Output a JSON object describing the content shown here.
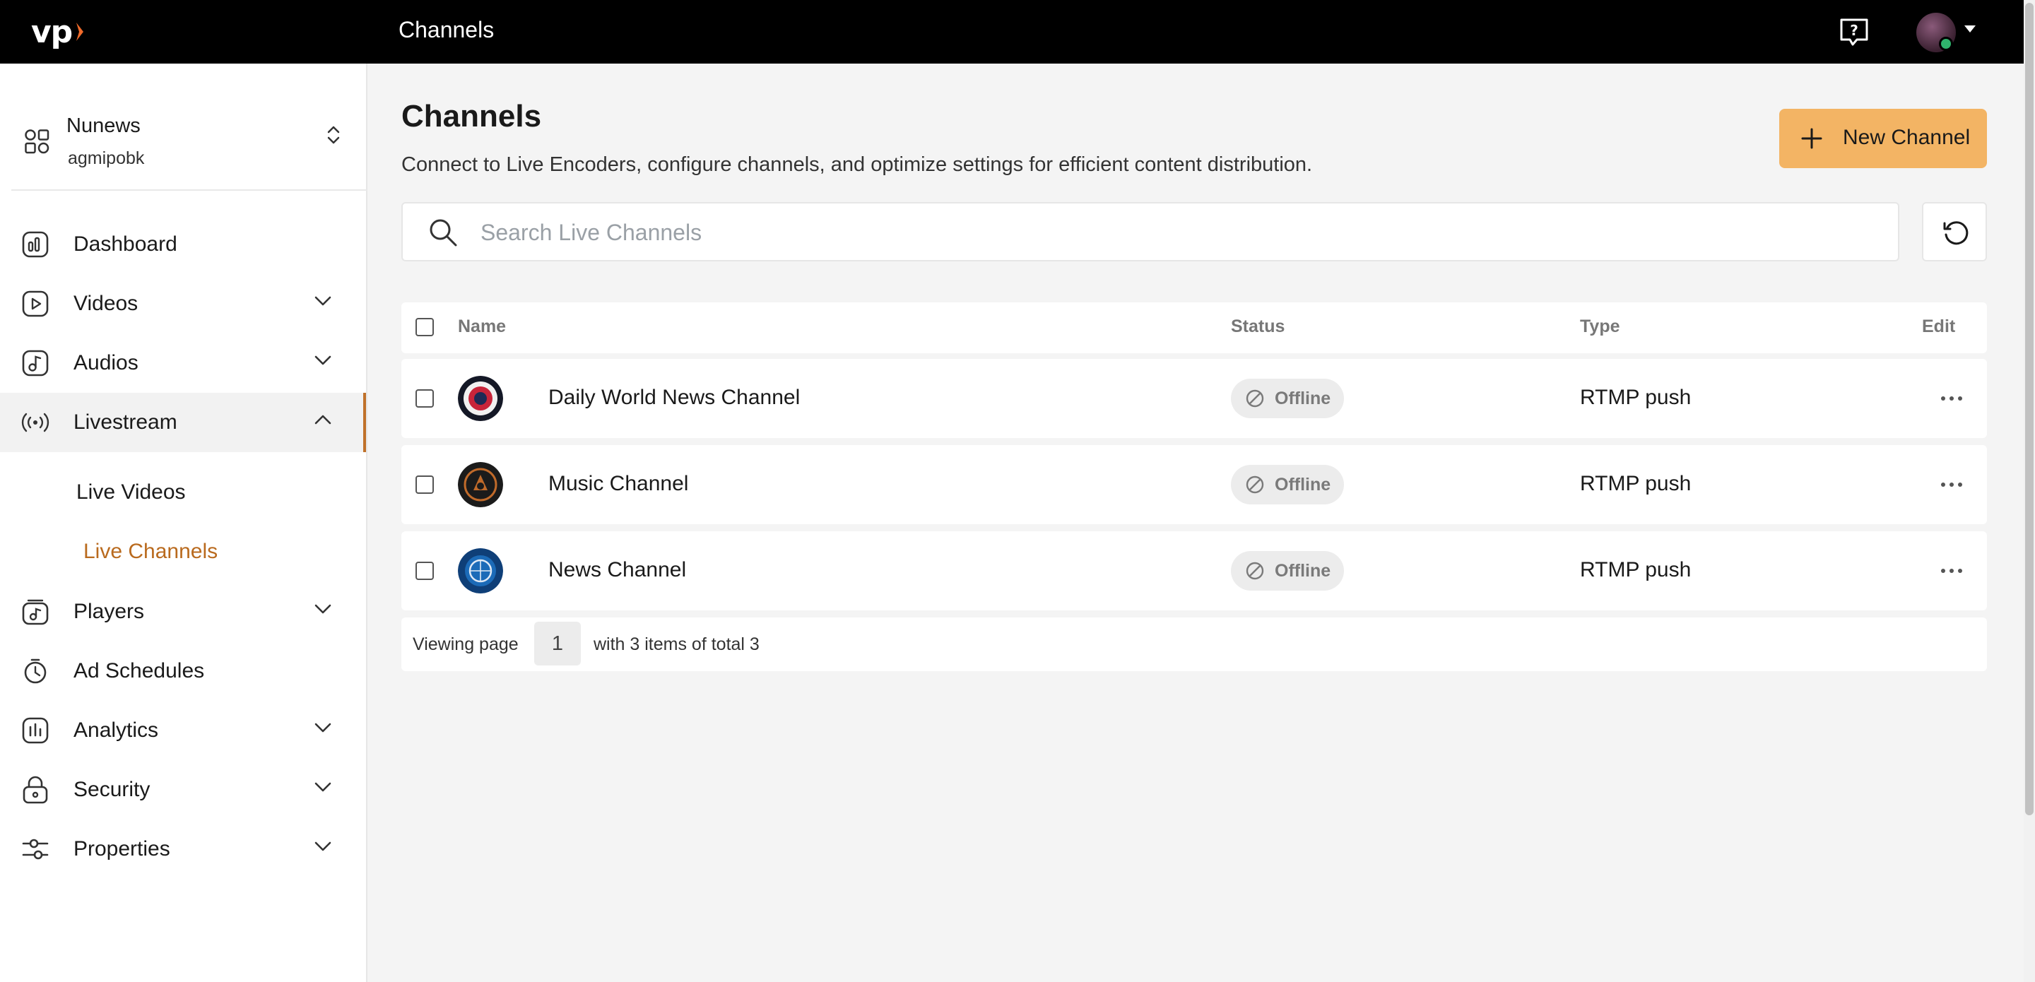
{
  "topbar": {
    "logo_text": "vp",
    "title": "Channels",
    "help_icon": "help-chat-icon",
    "avatar_status_color": "#2fb36c"
  },
  "sidebar": {
    "workspace": {
      "name": "Nunews",
      "sub": "agmipobk"
    },
    "items": [
      {
        "label": "Dashboard",
        "icon": "dashboard-icon"
      },
      {
        "label": "Videos",
        "icon": "video-icon"
      },
      {
        "label": "Audios",
        "icon": "audio-icon"
      },
      {
        "label": "Livestream",
        "icon": "livestream-icon"
      },
      {
        "label": "Players",
        "icon": "players-icon"
      },
      {
        "label": "Ad Schedules",
        "icon": "ad-schedule-icon"
      },
      {
        "label": "Analytics",
        "icon": "analytics-icon"
      },
      {
        "label": "Security",
        "icon": "lock-icon"
      },
      {
        "label": "Properties",
        "icon": "sliders-icon"
      }
    ],
    "livestream_sub": [
      {
        "label": "Live Videos"
      },
      {
        "label": "Live Channels"
      }
    ],
    "accent_color": "#b96a1e"
  },
  "main": {
    "title": "Channels",
    "description": "Connect to Live Encoders, configure channels, and optimize settings for efficient content distribution.",
    "new_button": "New Channel",
    "search_placeholder": "Search Live Channels",
    "columns": {
      "name": "Name",
      "status": "Status",
      "type": "Type",
      "edit": "Edit"
    },
    "rows": [
      {
        "name": "Daily World News Channel",
        "status": "Offline",
        "type": "RTMP push"
      },
      {
        "name": "Music Channel",
        "status": "Offline",
        "type": "RTMP push"
      },
      {
        "name": "News Channel",
        "status": "Offline",
        "type": "RTMP push"
      }
    ],
    "pager": {
      "prefix": "Viewing page",
      "page": "1",
      "suffix": "with 3 items of total 3"
    },
    "button_color": "#f3b464"
  }
}
